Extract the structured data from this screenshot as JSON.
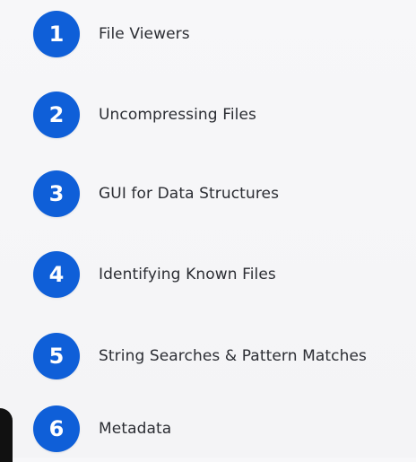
{
  "items": [
    {
      "number": "1",
      "label": "File Viewers"
    },
    {
      "number": "2",
      "label": "Uncompressing Files"
    },
    {
      "number": "3",
      "label": "GUI for Data Structures"
    },
    {
      "number": "4",
      "label": "Identifying Known Files"
    },
    {
      "number": "5",
      "label": "String Searches & Pattern Matches"
    },
    {
      "number": "6",
      "label": "Metadata"
    }
  ],
  "colors": {
    "badge": "#0f5fd8",
    "text": "#2b2d33",
    "background": "#f6f6f8"
  }
}
